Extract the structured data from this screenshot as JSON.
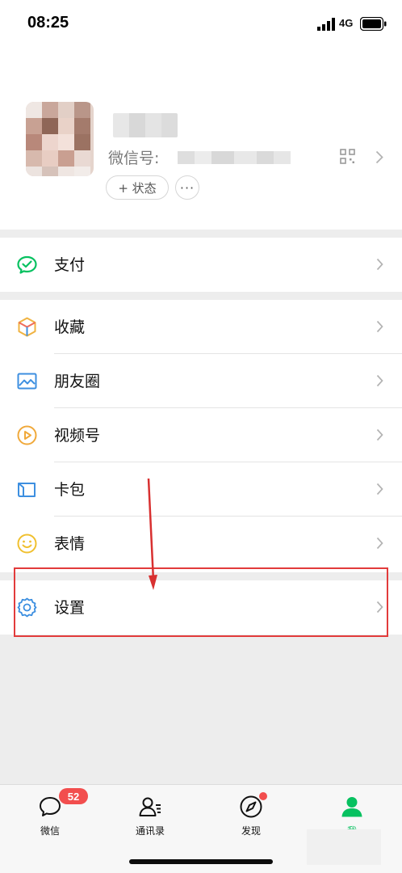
{
  "status_bar": {
    "time": "08:25",
    "network": "4G"
  },
  "profile": {
    "wechat_id_label": "微信号:",
    "status_button": "+ 状态",
    "more_button": "···"
  },
  "menu": {
    "pay": {
      "label": "支付",
      "icon": "wechat-pay-icon",
      "color": "#07c160"
    },
    "items": [
      {
        "label": "收藏",
        "icon": "favorites-cube-icon"
      },
      {
        "label": "朋友圈",
        "icon": "moments-picture-icon"
      },
      {
        "label": "视频号",
        "icon": "channels-play-icon"
      },
      {
        "label": "卡包",
        "icon": "card-wallet-icon"
      },
      {
        "label": "表情",
        "icon": "sticker-smile-icon"
      }
    ],
    "settings": {
      "label": "设置",
      "icon": "gear-icon"
    }
  },
  "tabbar": {
    "tabs": [
      {
        "label": "微信",
        "badge": "52"
      },
      {
        "label": "通讯录"
      },
      {
        "label": "发现"
      },
      {
        "label": "我"
      }
    ],
    "active_color": "#07c160"
  },
  "annotation_color": "#e23b3b"
}
